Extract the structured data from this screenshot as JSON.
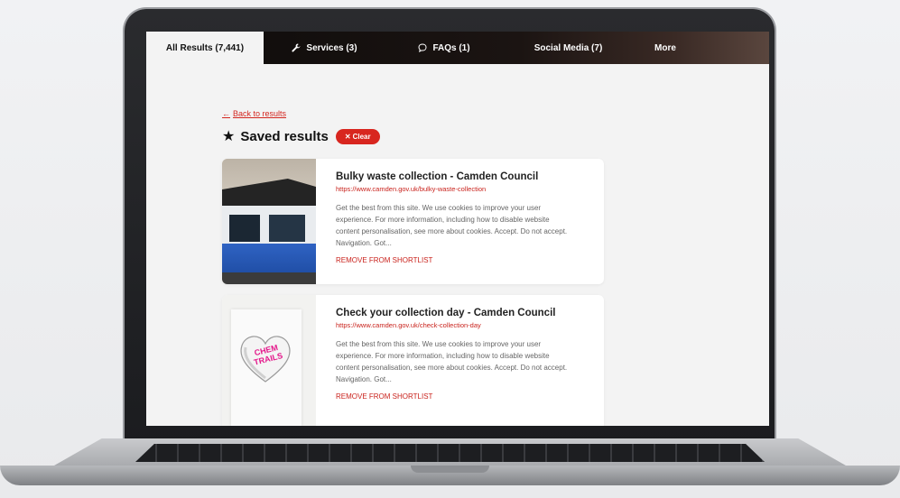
{
  "tabs": [
    {
      "label": "All Results (7,441)",
      "icon": "",
      "active": true
    },
    {
      "label": "Services (3)",
      "icon": "wrench-icon",
      "active": false
    },
    {
      "label": "FAQs (1)",
      "icon": "chat-bubble-icon",
      "active": false
    },
    {
      "label": "Social Media (7)",
      "icon": "",
      "active": false
    },
    {
      "label": "More",
      "icon": "",
      "active": false
    }
  ],
  "back_link": "Back to results",
  "heading": "Saved results",
  "clear_button": "Clear",
  "results": [
    {
      "title": "Bulky waste collection - Camden Council",
      "url": "https://www.camden.gov.uk/bulky-waste-collection",
      "description": "Get the best from this site. We use cookies to improve your user experience. For more information, including how to disable website content personalisation, see more about cookies. Accept. Do not accept. Navigation. Got...",
      "action": "REMOVE FROM SHORTLIST",
      "thumbnail": "car-photo"
    },
    {
      "title": "Check your collection day - Camden Council",
      "url": "https://www.camden.gov.uk/check-collection-day",
      "description": "Get the best from this site. We use cookies to improve your user experience. For more information, including how to disable website content personalisation, see more about cookies. Accept. Do not accept. Navigation. Got...",
      "action": "REMOVE FROM SHORTLIST",
      "thumbnail": "candy-heart-photo",
      "thumbnail_text": "CHEM TRAILS"
    }
  ],
  "colors": {
    "accent_red": "#d8261f",
    "tabbar_dark": "#0d0b0a"
  }
}
